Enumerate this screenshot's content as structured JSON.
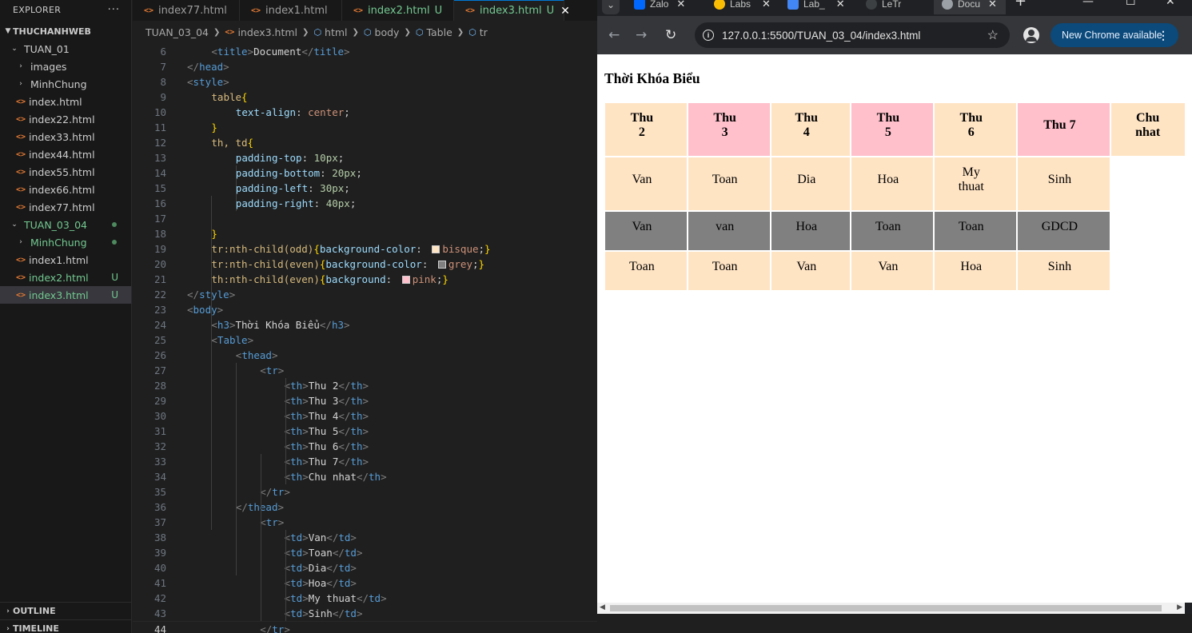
{
  "explorer": {
    "title": "EXPLORER",
    "more": "···",
    "root": "THUCHANHWEB",
    "items": [
      {
        "label": "TUAN_01",
        "kind": "folder-open",
        "indent": 1,
        "status": ""
      },
      {
        "label": "images",
        "kind": "folder",
        "indent": 2,
        "status": ""
      },
      {
        "label": "MinhChung",
        "kind": "folder",
        "indent": 2,
        "status": ""
      },
      {
        "label": "index.html",
        "kind": "file",
        "indent": 2,
        "status": ""
      },
      {
        "label": "index22.html",
        "kind": "file",
        "indent": 2,
        "status": ""
      },
      {
        "label": "index33.html",
        "kind": "file",
        "indent": 2,
        "status": ""
      },
      {
        "label": "index44.html",
        "kind": "file",
        "indent": 2,
        "status": ""
      },
      {
        "label": "index55.html",
        "kind": "file",
        "indent": 2,
        "status": ""
      },
      {
        "label": "index66.html",
        "kind": "file",
        "indent": 2,
        "status": ""
      },
      {
        "label": "index77.html",
        "kind": "file",
        "indent": 2,
        "status": ""
      },
      {
        "label": "TUAN_03_04",
        "kind": "folder-open",
        "indent": 1,
        "status": "dot",
        "green": true
      },
      {
        "label": "MinhChung",
        "kind": "folder",
        "indent": 2,
        "status": "dot",
        "green": true
      },
      {
        "label": "index1.html",
        "kind": "file",
        "indent": 2,
        "status": ""
      },
      {
        "label": "index2.html",
        "kind": "file",
        "indent": 2,
        "status": "U",
        "green": true
      },
      {
        "label": "index3.html",
        "kind": "file",
        "indent": 2,
        "status": "U",
        "green": true,
        "selected": true
      }
    ],
    "outline": "OUTLINE",
    "timeline": "TIMELINE"
  },
  "editor": {
    "tabs": [
      {
        "label": "index77.html",
        "status": ""
      },
      {
        "label": "index1.html",
        "status": ""
      },
      {
        "label": "index2.html",
        "status": "U"
      },
      {
        "label": "index3.html",
        "status": "U",
        "active": true
      }
    ],
    "breadcrumb": [
      "TUAN_03_04",
      "index3.html",
      "html",
      "body",
      "Table",
      "tr"
    ],
    "current_line": 44
  },
  "browser": {
    "tabs": [
      "Zalo",
      "Labs",
      "Lab_",
      "LeTr",
      "Docu"
    ],
    "url": "127.0.0.1:5500/TUAN_03_04/index3.html",
    "update_label": "New Chrome available",
    "page": {
      "heading": "Thời Khóa Biểu",
      "headers": [
        "Thu 2",
        "Thu 3",
        "Thu 4",
        "Thu 5",
        "Thu 6",
        "Thu 7",
        "Chu nhat"
      ],
      "rows": [
        [
          "Van",
          "Toan",
          "Dia",
          "Hoa",
          "My thuat",
          "Sinh"
        ],
        [
          "Van",
          "van",
          "Hoa",
          "Toan",
          "Toan",
          "GDCD"
        ],
        [
          "Toan",
          "Toan",
          "Van",
          "Van",
          "Hoa",
          "Sinh"
        ]
      ]
    }
  },
  "colors": {
    "bisque": "#ffe4c4",
    "grey": "#808080",
    "pink": "#ffc0cb",
    "accent": "#0078d4",
    "git_untracked": "#73c991"
  }
}
